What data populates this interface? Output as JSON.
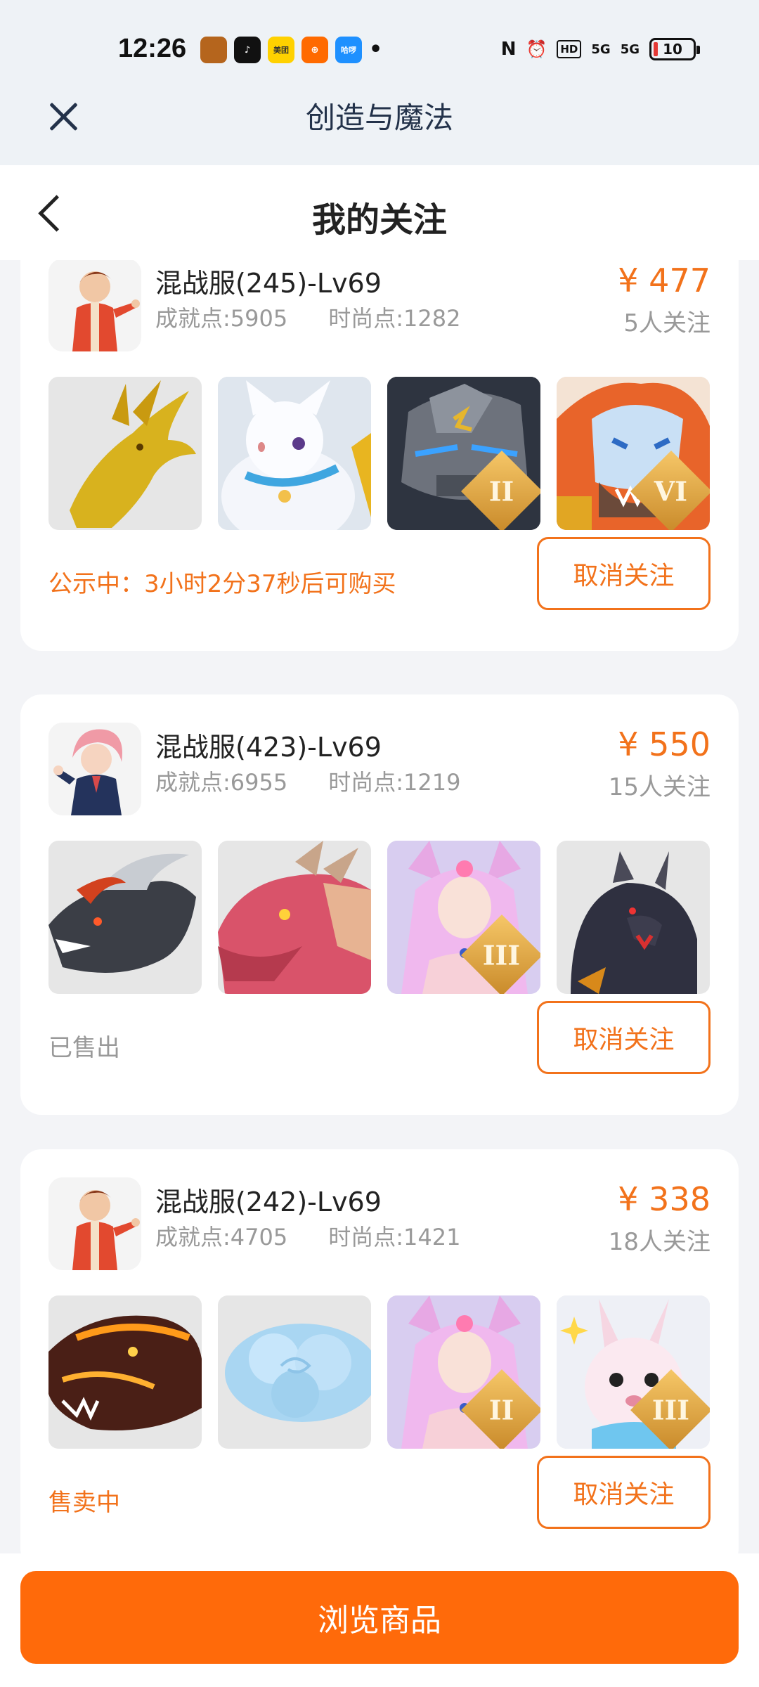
{
  "status_bar": {
    "time": "12:26",
    "apps": [
      {
        "icon": "game-app-icon",
        "color": "#b5651d",
        "label": ""
      },
      {
        "icon": "tiktok-app-icon",
        "color": "#111111",
        "label": "♪"
      },
      {
        "icon": "meituan-app-icon",
        "color": "#ffd100",
        "label": "美团"
      },
      {
        "icon": "taobao-app-icon",
        "color": "#ff6a00",
        "label": "⊕"
      },
      {
        "icon": "hello-app-icon",
        "color": "#1e90ff",
        "label": "哈啰"
      }
    ],
    "dot": "•",
    "nfc": "N",
    "alarm": "⏰",
    "hd": "HD",
    "signal1": "5G",
    "signal2": "5G",
    "battery": "10"
  },
  "titlebar": {
    "title": "创造与魔法"
  },
  "header": {
    "title": "我的关注"
  },
  "colors": {
    "accent": "#f2721b",
    "button": "#ff6a0a"
  },
  "cards": [
    {
      "title": "混战服(245)-Lv69",
      "achievement": "成就点:5905",
      "fashion": "时尚点:1282",
      "price": "¥ 477",
      "followers": "5人关注",
      "thumbs": [
        {
          "name": "golden-dragon-image",
          "badge": ""
        },
        {
          "name": "white-cat-image",
          "badge": ""
        },
        {
          "name": "stone-golem-image",
          "badge": "II"
        },
        {
          "name": "fire-lion-image",
          "badge": "VI"
        }
      ],
      "status": "公示中：3小时2分37秒后可购买",
      "status_style": "orange",
      "button": "取消关注"
    },
    {
      "title": "混战服(423)-Lv69",
      "achievement": "成就点:6955",
      "fashion": "时尚点:1219",
      "price": "¥ 550",
      "followers": "15人关注",
      "thumbs": [
        {
          "name": "black-dragon-image",
          "badge": ""
        },
        {
          "name": "red-dragon-image",
          "badge": ""
        },
        {
          "name": "fox-girl-image",
          "badge": "III"
        },
        {
          "name": "black-beast-image",
          "badge": ""
        }
      ],
      "status": "已售出",
      "status_style": "gray",
      "button": "取消关注"
    },
    {
      "title": "混战服(242)-Lv69",
      "achievement": "成就点:4705",
      "fashion": "时尚点:1421",
      "price": "¥ 338",
      "followers": "18人关注",
      "thumbs": [
        {
          "name": "lava-dragon-image",
          "badge": ""
        },
        {
          "name": "blue-cloud-image",
          "badge": ""
        },
        {
          "name": "fox-girl-image",
          "badge": "II"
        },
        {
          "name": "pink-rabbit-image",
          "badge": "III"
        }
      ],
      "status": "售卖中",
      "status_style": "orange",
      "button": "取消关注"
    }
  ],
  "bottom": {
    "browse_label": "浏览商品"
  }
}
